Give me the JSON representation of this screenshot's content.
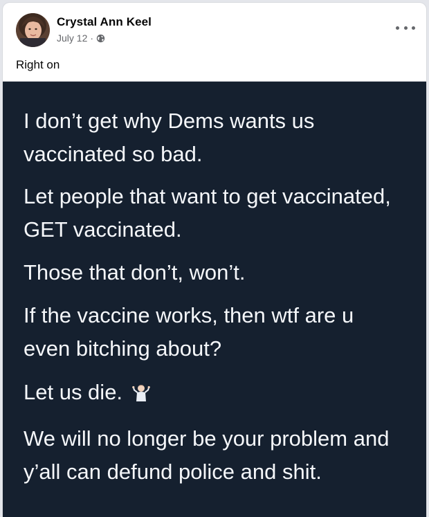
{
  "post": {
    "author": "Crystal Ann Keel",
    "date": "July 12",
    "separator": "·",
    "privacy_icon": "globe-icon",
    "more_icon": "more-options-icon",
    "caption": "Right on"
  },
  "image_text": {
    "line1": "I don’t get why Dems wants us",
    "line2": "vaccinated so bad.",
    "line3": "Let people that want to get vaccinated,",
    "line4": "GET vaccinated.",
    "line5": "Those that don’t, won’t.",
    "line6": "If the vaccine works, then wtf are u",
    "line7": "even bitching about?",
    "line8": "Let us die.",
    "line8_emoji": "person-shrugging-emoji",
    "line9": "We will no longer be your problem and",
    "line10": "y’all can defund police and shit."
  },
  "colors": {
    "card_bg": "#ffffff",
    "page_bg": "#e4e6eb",
    "media_bg": "#15202f",
    "media_text": "#f5f7fa",
    "meta_text": "#65676b",
    "primary_text": "#050505"
  }
}
